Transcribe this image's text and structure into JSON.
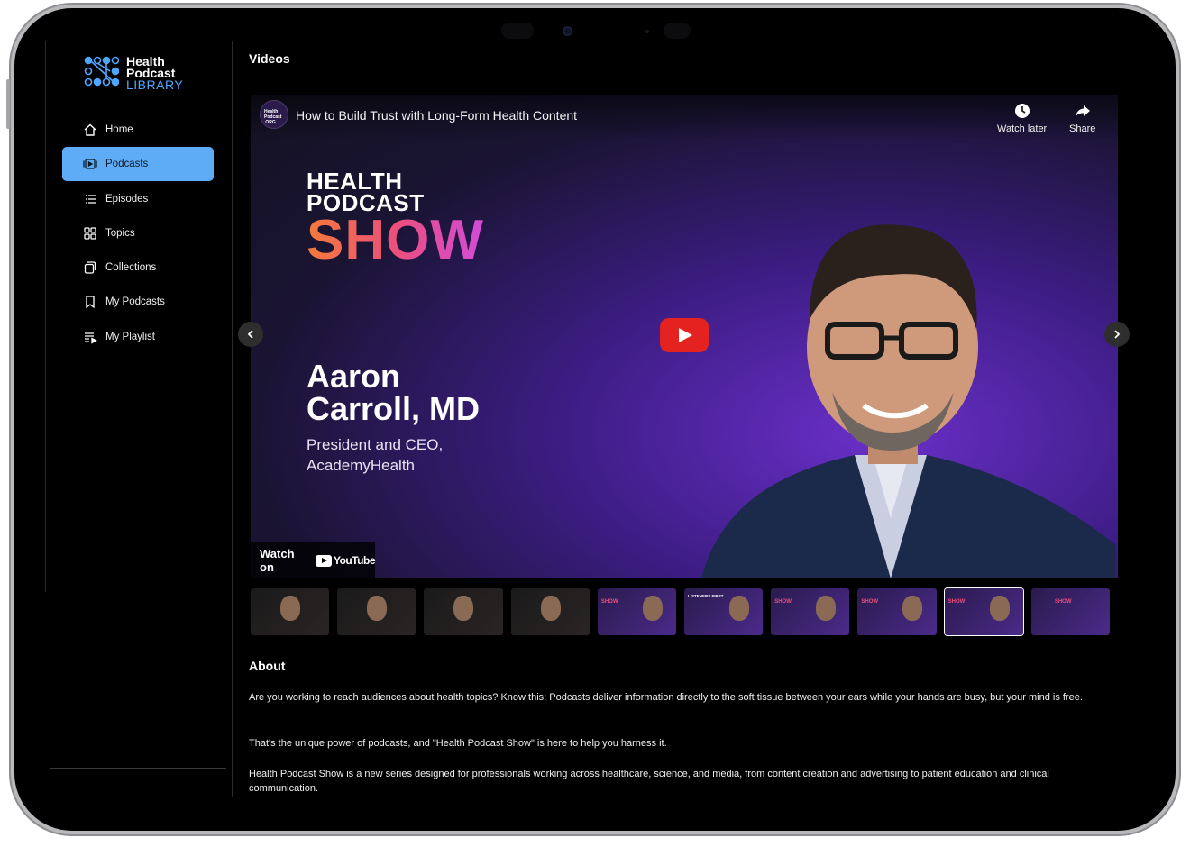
{
  "brand": {
    "logo_line1": "Health",
    "logo_line2": "Podcast",
    "logo_line3": "LIBRARY",
    "accent_color": "#5eacf5"
  },
  "sidebar": {
    "items": [
      {
        "label": "Home",
        "icon": "home-icon"
      },
      {
        "label": "Podcasts",
        "icon": "podcast-play-icon",
        "active": true
      },
      {
        "label": "Episodes",
        "icon": "list-icon"
      },
      {
        "label": "Topics",
        "icon": "grid-icon"
      },
      {
        "label": "Collections",
        "icon": "collections-icon"
      },
      {
        "label": "My Podcasts",
        "icon": "bookmark-icon"
      },
      {
        "label": "My Playlist",
        "icon": "playlist-icon"
      }
    ]
  },
  "main": {
    "section_title": "Videos",
    "player": {
      "channel_avatar_text": "Health Podcast .ORG",
      "video_title": "How to Build Trust with Long-Form Health Content",
      "watch_later_label": "Watch later",
      "share_label": "Share",
      "brand_line1": "HEALTH",
      "brand_line2": "PODCAST",
      "brand_line3": "SHOW",
      "guest_name_line1": "Aaron",
      "guest_name_line2": "Carroll, MD",
      "guest_role_line1": "President and CEO,",
      "guest_role_line2": "AcademyHealth",
      "watch_on_label": "Watch on",
      "youtube_label": "YouTube",
      "play_button_color": "#e42320"
    },
    "thumbnails": [
      {
        "style": "dark",
        "label": ""
      },
      {
        "style": "dark",
        "label": ""
      },
      {
        "style": "dark",
        "label": ""
      },
      {
        "style": "dark",
        "label": ""
      },
      {
        "style": "purple",
        "label": "SHOW"
      },
      {
        "style": "purple",
        "label": "LISTENERS FIRST"
      },
      {
        "style": "purple",
        "label": "SHOW"
      },
      {
        "style": "purple",
        "label": "SHOW"
      },
      {
        "style": "purple",
        "label": "SHOW",
        "selected": true
      },
      {
        "style": "purple",
        "label": "SHOW"
      }
    ],
    "about": {
      "title": "About",
      "paragraphs": [
        "Are you working to reach audiences about health topics? Know this: Podcasts deliver information directly to the soft tissue between your ears while your hands are busy, but your mind is free.",
        "That's the unique power of podcasts, and \"Health Podcast Show\" is here to help you harness it.",
        "Health Podcast Show is a new series designed for professionals working across healthcare, science, and media, from content creation and advertising to patient education and clinical communication."
      ]
    }
  }
}
